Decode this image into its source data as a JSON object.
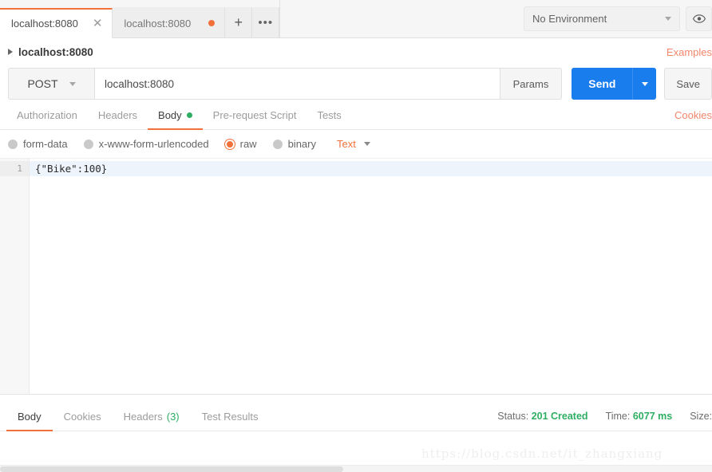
{
  "tabbar": {
    "tabs": [
      {
        "label": "localhost:8080",
        "active": true,
        "close_icon": "close-icon"
      },
      {
        "label": "localhost:8080",
        "active": false,
        "unsaved": true
      }
    ],
    "new_tab_label": "+",
    "more_label": "•••",
    "environment": {
      "value": "No Environment"
    },
    "eye_icon": "eye-icon"
  },
  "breadcrumb": {
    "label": "localhost:8080",
    "examples_link": "Examples"
  },
  "request": {
    "method": "POST",
    "url": "localhost:8080",
    "params_label": "Params",
    "send_label": "Send",
    "save_label": "Save"
  },
  "request_tabs": [
    {
      "label": "Authorization",
      "active": false
    },
    {
      "label": "Headers",
      "active": false
    },
    {
      "label": "Body",
      "active": true,
      "dot": true
    },
    {
      "label": "Pre-request Script",
      "active": false
    },
    {
      "label": "Tests",
      "active": false
    }
  ],
  "cookies_link": "Cookies",
  "body_types": [
    {
      "label": "form-data",
      "selected": false
    },
    {
      "label": "x-www-form-urlencoded",
      "selected": false
    },
    {
      "label": "raw",
      "selected": true
    },
    {
      "label": "binary",
      "selected": false
    }
  ],
  "body_format": "Text",
  "editor": {
    "lines": [
      {
        "num": "1",
        "text": "{\"Bike\":100}"
      }
    ]
  },
  "response_tabs": [
    {
      "label": "Body",
      "active": true
    },
    {
      "label": "Cookies",
      "active": false
    },
    {
      "label": "Headers",
      "count": "(3)",
      "active": false
    },
    {
      "label": "Test Results",
      "active": false
    }
  ],
  "response_meta": {
    "status_label": "Status:",
    "status_value": "201 Created",
    "time_label": "Time:",
    "time_value": "6077 ms",
    "size_label": "Size:"
  },
  "watermark": "https://blog.csdn.net/it_zhangxiang",
  "colors": {
    "accent_orange": "#f2713b",
    "send_blue": "#1a7ded",
    "success_green": "#2eae62"
  }
}
